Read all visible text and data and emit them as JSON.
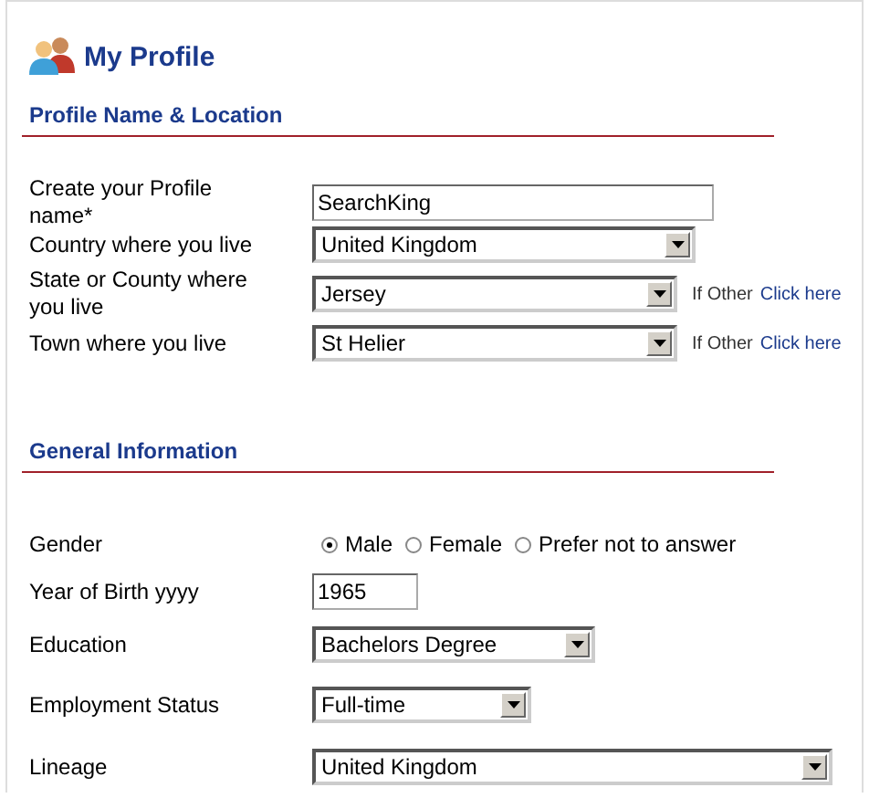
{
  "page_title": "My Profile",
  "sections": [
    {
      "title": "Profile Name & Location",
      "fields": [
        {
          "kind": "text",
          "label": "Create your Profile name*",
          "value": "SearchKing"
        },
        {
          "kind": "select",
          "label": "Country where you live",
          "value": "United Kingdom"
        },
        {
          "kind": "select",
          "label": "State or County where you live",
          "value": "Jersey",
          "note": "If Other",
          "link": "Click here"
        },
        {
          "kind": "select",
          "label": "Town where you live",
          "value": "St Helier",
          "note": "If Other",
          "link": "Click here"
        }
      ]
    },
    {
      "title": "General Information",
      "fields": [
        {
          "kind": "radio",
          "label": "Gender",
          "options": [
            {
              "label": "Male",
              "selected": true
            },
            {
              "label": "Female",
              "selected": false
            },
            {
              "label": "Prefer not to answer",
              "selected": false
            }
          ]
        },
        {
          "kind": "text",
          "label": "Year of Birth yyyy",
          "value": "1965"
        },
        {
          "kind": "select",
          "label": "Education",
          "value": "Bachelors Degree"
        },
        {
          "kind": "select",
          "label": "Employment Status",
          "value": "Full-time"
        },
        {
          "kind": "select",
          "label": "Lineage",
          "value": "United Kingdom"
        }
      ]
    }
  ]
}
